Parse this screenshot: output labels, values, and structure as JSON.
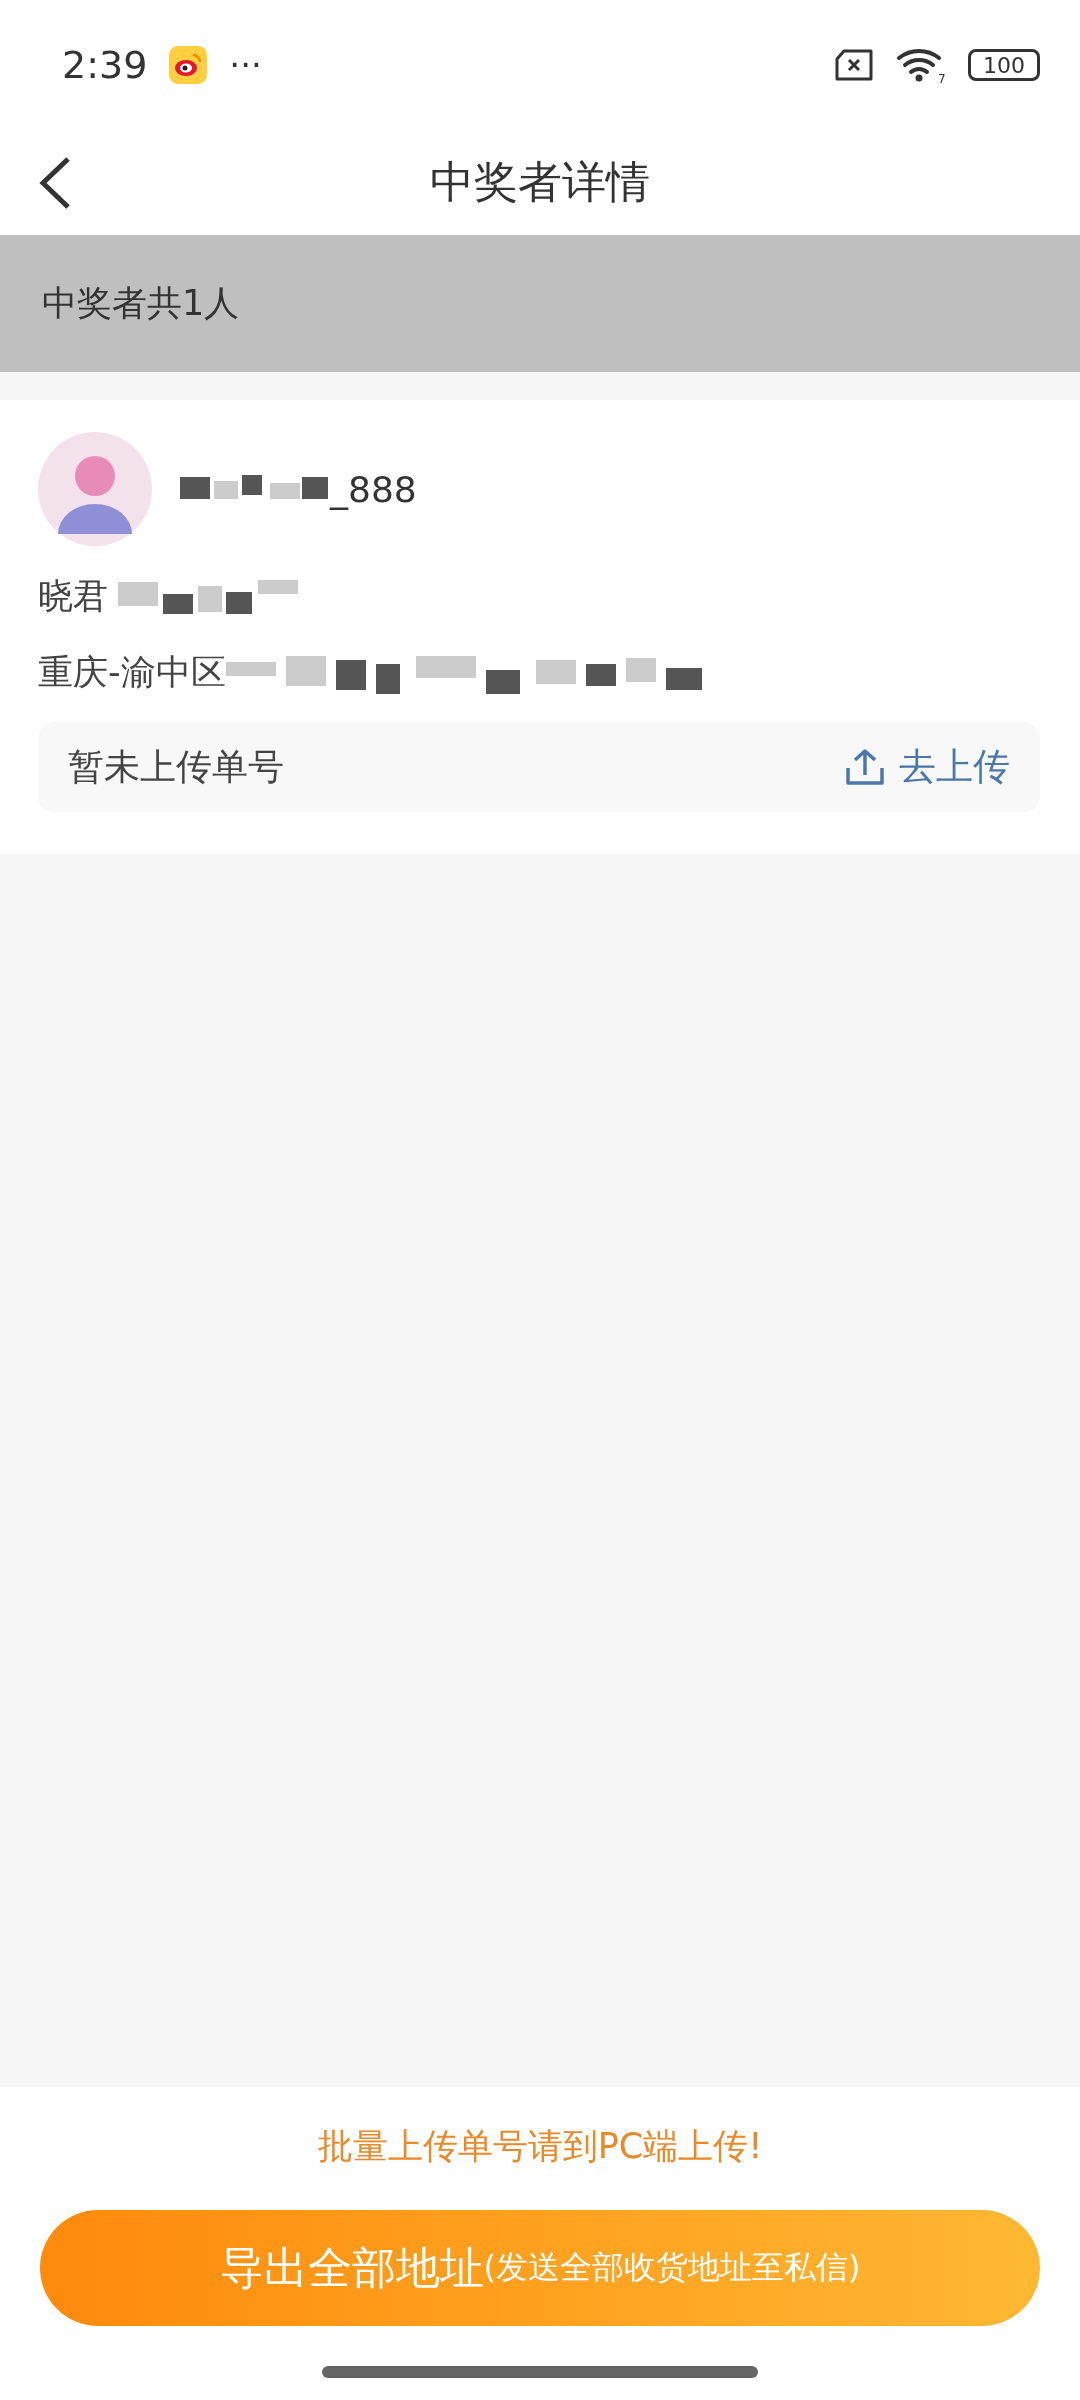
{
  "status_bar": {
    "time": "2:39",
    "more": "···",
    "battery": "100",
    "wifi_badge": "7"
  },
  "header": {
    "title": "中奖者详情"
  },
  "summary": {
    "text": "中奖者共1人"
  },
  "winners": [
    {
      "username": "_888",
      "name": "晓君",
      "address": "重庆-渝中区",
      "tracking_status": "暂未上传单号",
      "upload_label": "去上传"
    }
  ],
  "footer": {
    "hint": "批量上传单号请到PC端上传!",
    "export_button": {
      "label": "导出全部地址",
      "note": "(发送全部收货地址至私信)"
    }
  }
}
